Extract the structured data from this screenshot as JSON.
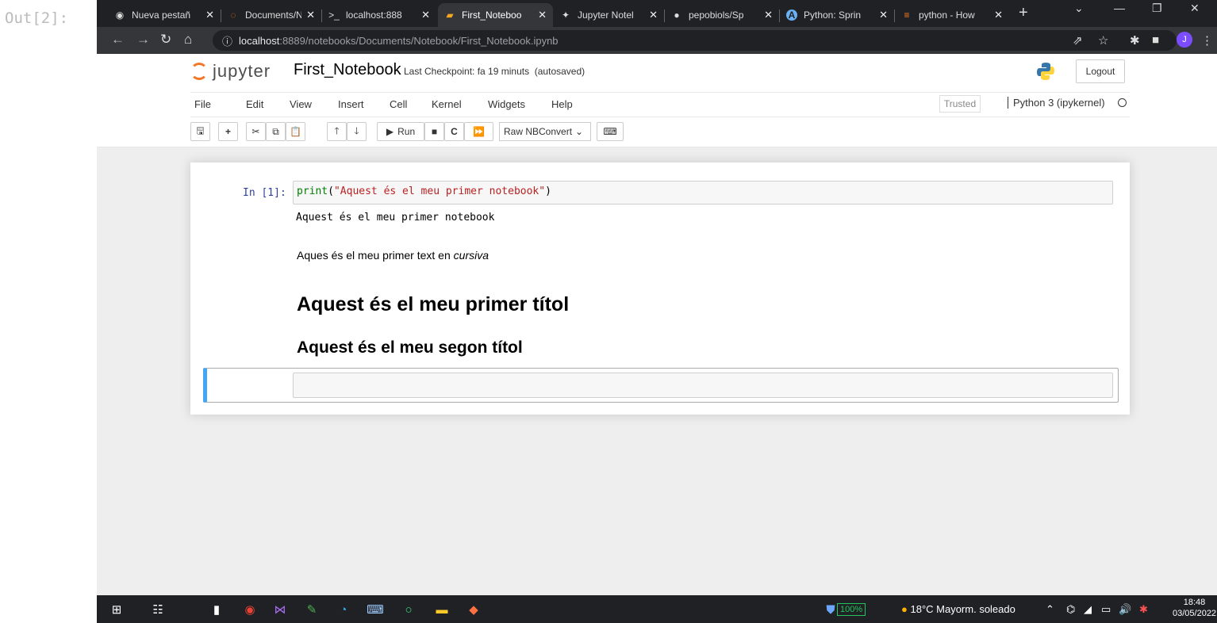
{
  "output_prompt": "Out[2]:",
  "browser": {
    "tabs": [
      {
        "title": "Nueva pestañ",
        "icon": "chrome-icon"
      },
      {
        "title": "Documents/N",
        "icon": "jupyter-icon"
      },
      {
        "title": "localhost:888",
        "icon": "terminal-icon"
      },
      {
        "title": "First_Noteboo",
        "icon": "notebook-icon",
        "active": true
      },
      {
        "title": "Jupyter Notel",
        "icon": "jupyter-plugin-icon"
      },
      {
        "title": "pepobiols/Sp",
        "icon": "github-icon"
      },
      {
        "title": "Python: Sprin",
        "icon": "python-a-icon"
      },
      {
        "title": "python - How",
        "icon": "stackoverflow-icon"
      }
    ],
    "url_host": "localhost",
    "url_rest": ":8889/notebooks/Documents/Notebook/First_Notebook.ipynb",
    "profile_initial": "J"
  },
  "jupyter": {
    "logo_text": "jupyter",
    "notebook_name": "First_Notebook",
    "checkpoint": "Last Checkpoint: fa 19 minuts",
    "autosaved": "(autosaved)",
    "logout": "Logout",
    "menu": [
      "File",
      "Edit",
      "View",
      "Insert",
      "Cell",
      "Kernel",
      "Widgets",
      "Help"
    ],
    "trusted": "Trusted",
    "kernel": "Python 3 (ipykernel)",
    "toolbar": {
      "run": "Run",
      "cell_type": "Raw NBConvert"
    }
  },
  "cells": {
    "code_prompt": "In [1]:",
    "code_fn": "print",
    "code_open": "(",
    "code_str": "\"Aquest és el meu primer notebook\"",
    "code_close": ")",
    "output": "Aquest és el meu primer notebook",
    "md_text_prefix": "Aques és el meu primer text en",
    "md_text_italic": "cursiva",
    "h1": "Aquest és el meu primer títol",
    "h2": "Aquest és el meu segon títol"
  },
  "taskbar": {
    "battery": "100%",
    "weather": "18°C  Mayorm. soleado",
    "time": "18:48",
    "date": "03/05/2022"
  }
}
